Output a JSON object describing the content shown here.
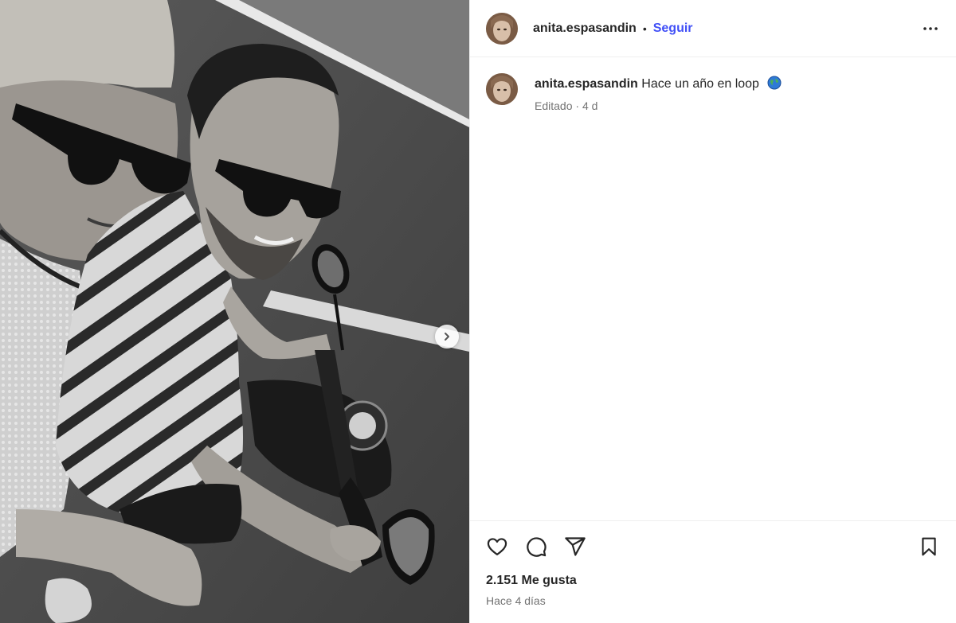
{
  "header": {
    "username": "anita.espasandin",
    "separator": "•",
    "follow_label": "Seguir",
    "more_icon": "more-horizontal-icon"
  },
  "caption": {
    "username": "anita.espasandin",
    "text": "Hace un año en loop",
    "emoji_icon": "globe-icon",
    "edited_label": "Editado",
    "meta_separator": " · ",
    "age": "4 d"
  },
  "actions": {
    "like_icon": "heart-icon",
    "comment_icon": "comment-icon",
    "share_icon": "send-icon",
    "save_icon": "bookmark-icon"
  },
  "likes": {
    "label": "2.151 Me gusta"
  },
  "timestamp": {
    "label": "Hace 4 días"
  },
  "media": {
    "next_icon": "chevron-right-icon"
  },
  "colors": {
    "accent": "#4150f7",
    "text": "#262626",
    "muted": "#737373",
    "border": "#efefef"
  }
}
